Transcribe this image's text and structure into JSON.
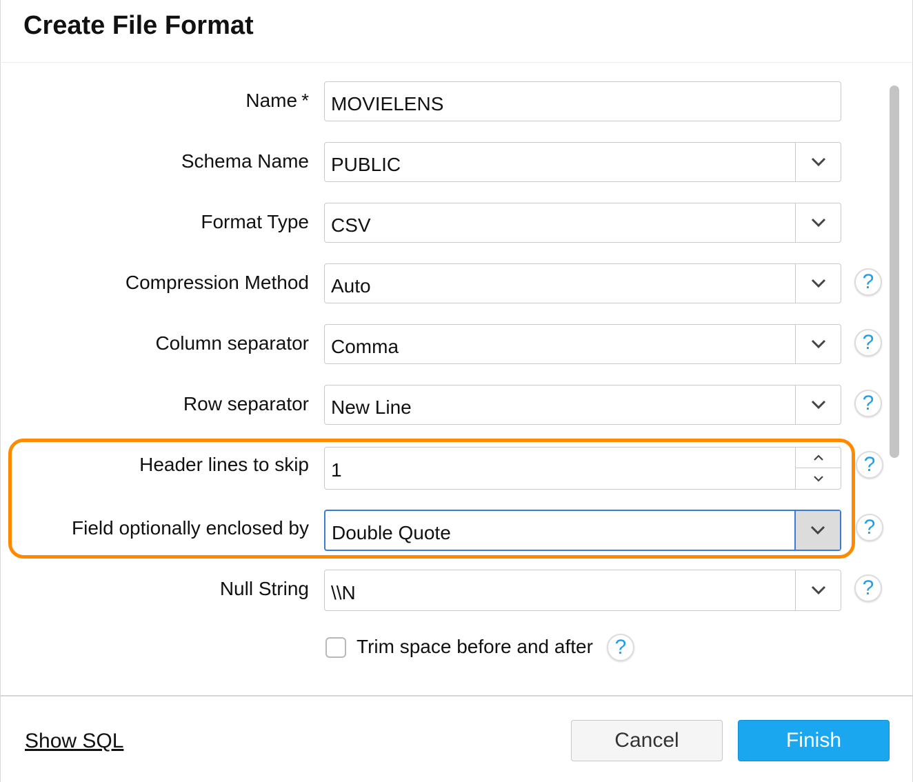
{
  "dialog": {
    "title": "Create File Format"
  },
  "form": {
    "name": {
      "label": "Name",
      "required_mark": "*",
      "value": "MOVIELENS"
    },
    "schema_name": {
      "label": "Schema Name",
      "value": "PUBLIC"
    },
    "format_type": {
      "label": "Format Type",
      "value": "CSV"
    },
    "compression_method": {
      "label": "Compression Method",
      "value": "Auto"
    },
    "column_separator": {
      "label": "Column separator",
      "value": "Comma"
    },
    "row_separator": {
      "label": "Row separator",
      "value": "New Line"
    },
    "header_lines_to_skip": {
      "label": "Header lines to skip",
      "value": "1"
    },
    "field_enclosed_by": {
      "label": "Field optionally enclosed by",
      "value": "Double Quote"
    },
    "null_string": {
      "label": "Null String",
      "value": "\\\\N"
    },
    "trim_space": {
      "label": "Trim space before and after",
      "checked": false
    }
  },
  "help_icon_glyph": "?",
  "footer": {
    "show_sql": "Show SQL",
    "cancel": "Cancel",
    "finish": "Finish"
  },
  "colors": {
    "accent": "#1aa7ef",
    "highlight": "#ff8a00",
    "focus": "#3a7bd5",
    "help_icon": "#1e9fe8"
  }
}
